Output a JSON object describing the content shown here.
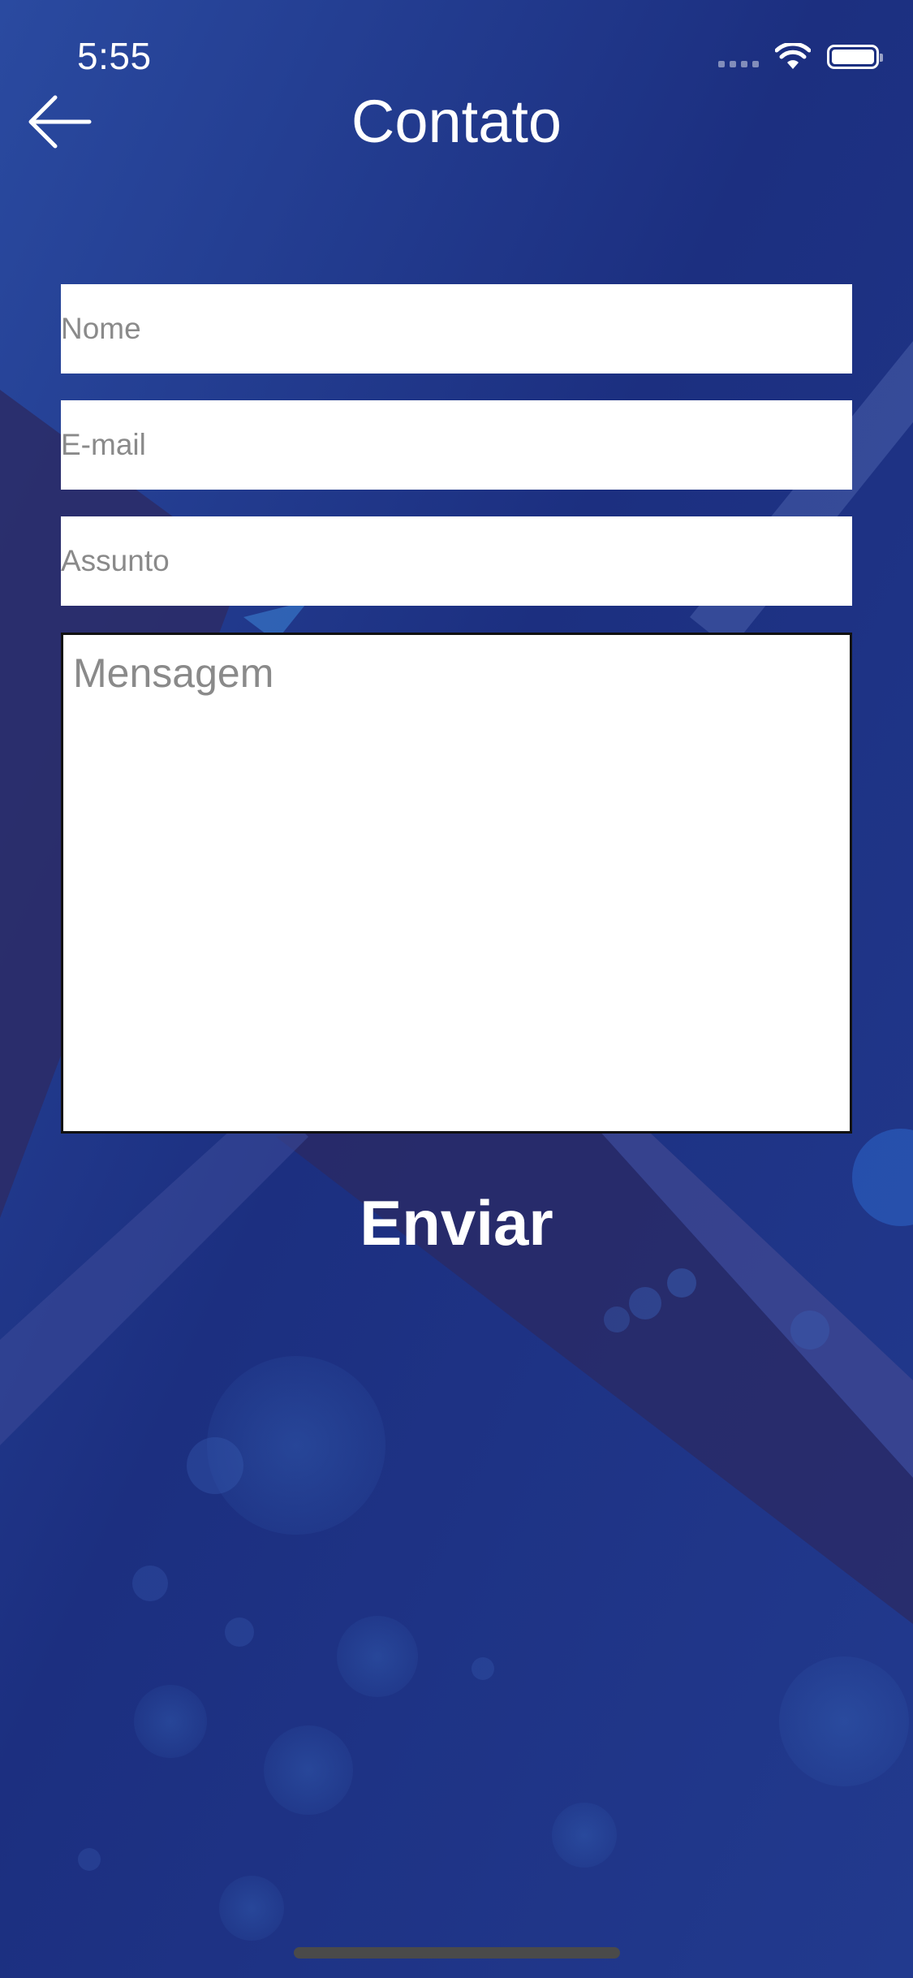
{
  "status_bar": {
    "time": "5:55"
  },
  "header": {
    "title": "Contato",
    "back_icon": "arrow-left-icon"
  },
  "form": {
    "name_placeholder": "Nome",
    "email_placeholder": "E-mail",
    "subject_placeholder": "Assunto",
    "message_placeholder": "Mensagem",
    "send_label": "Enviar"
  },
  "colors": {
    "background": "#1f3688",
    "text": "#ffffff",
    "field_background": "#ffffff",
    "placeholder": "#8a8a8a"
  }
}
